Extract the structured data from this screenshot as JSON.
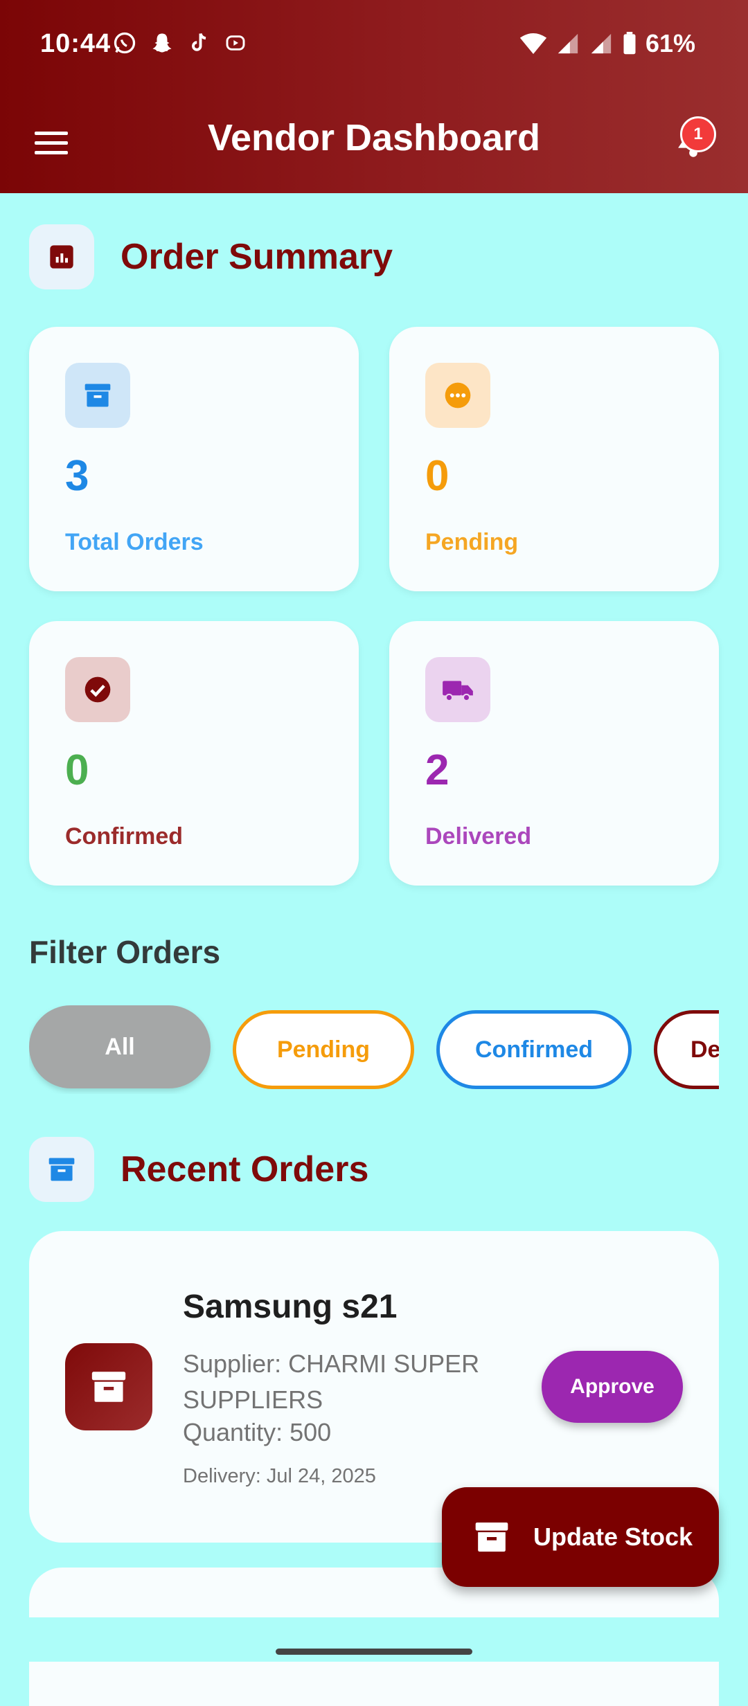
{
  "status_bar": {
    "time": "10:44",
    "battery": "61%",
    "notification_icons": [
      "whatsapp-icon",
      "snapchat-icon",
      "tiktok-icon",
      "media-icon"
    ]
  },
  "app_bar": {
    "title": "Vendor Dashboard",
    "notification_count": "1"
  },
  "order_summary": {
    "title": "Order Summary",
    "cards": [
      {
        "value": "3",
        "label": "Total Orders",
        "icon": "archive-icon",
        "color": "#1e88e5",
        "label_color": "#42a5f5",
        "icon_bg": "#cfe6f8"
      },
      {
        "value": "0",
        "label": "Pending",
        "icon": "pending-icon",
        "color": "#f59c0b",
        "label_color": "#f5a623",
        "icon_bg": "#fde5c6"
      },
      {
        "value": "0",
        "label": "Confirmed",
        "icon": "check-circle-icon",
        "color": "#4caf50",
        "label_color": "#9b2b2b",
        "icon_bg": "#e9cccb"
      },
      {
        "value": "2",
        "label": "Delivered",
        "icon": "truck-icon",
        "color": "#9c27b0",
        "label_color": "#ab47bc",
        "icon_bg": "#ebd3ef"
      }
    ]
  },
  "filter": {
    "title": "Filter Orders",
    "chips": [
      {
        "label": "All",
        "selected": true
      },
      {
        "label": "Pending",
        "color": "#f59c0b"
      },
      {
        "label": "Confirmed",
        "color": "#1e88e5"
      },
      {
        "label": "De",
        "color": "#7f0a0a"
      }
    ]
  },
  "recent_orders": {
    "title": "Recent Orders",
    "orders": [
      {
        "name": "Samsung s21",
        "supplier": "Supplier: CHARMI SUPER SUPPLIERS",
        "quantity": "Quantity: 500",
        "delivery": "Delivery: Jul 24, 2025",
        "action_label": "Approve"
      }
    ]
  },
  "fab": {
    "label": "Update Stock"
  },
  "colors": {
    "brand": "#7f0a0a",
    "background": "#adfdf9",
    "approve": "#9c27b0"
  }
}
